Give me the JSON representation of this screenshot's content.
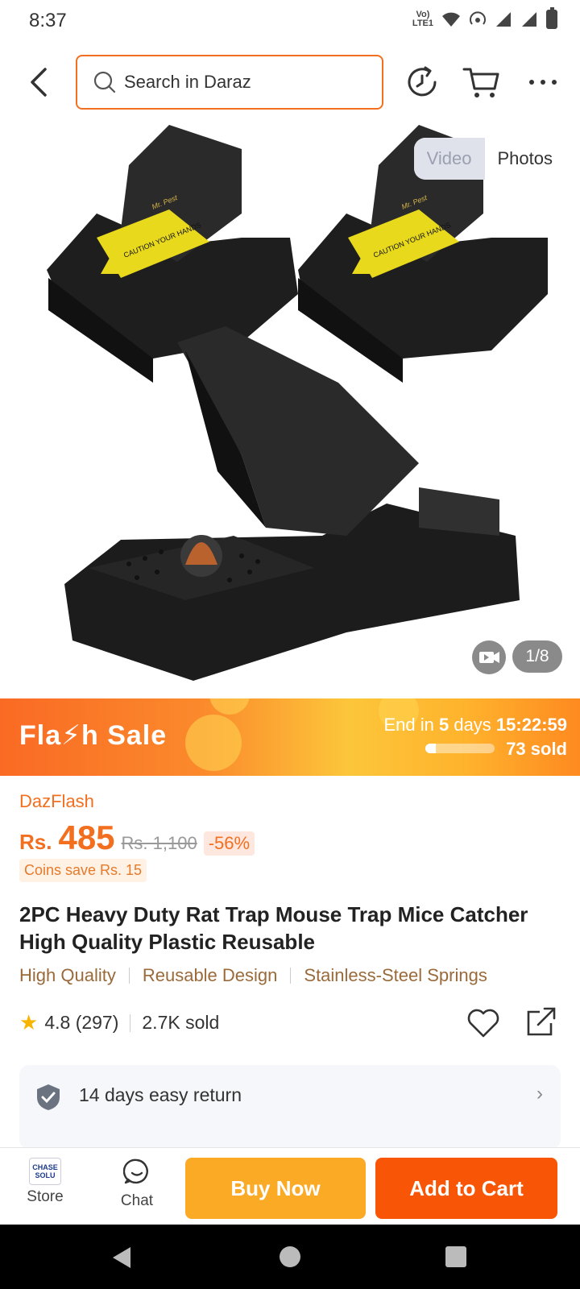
{
  "status_bar": {
    "time": "8:37",
    "lte_top": "Vo)",
    "lte_bottom": "LTE1"
  },
  "header": {
    "search_placeholder": "Search in Daraz"
  },
  "gallery": {
    "video_label": "Video",
    "photos_label": "Photos",
    "counter": "1/8",
    "trap_brand": "Mr. Pest",
    "trap_warning": "CAUTION YOUR HANDS"
  },
  "flash_sale": {
    "title": "Fla⚡h  Sale",
    "end_prefix": "End in ",
    "end_days": "5",
    "end_days_suffix": " days ",
    "end_time": "15:22:59",
    "sold_text": "73 sold",
    "progress": 0.15
  },
  "price": {
    "campaign": "DazFlash",
    "currency": "Rs.",
    "current": "485",
    "original": "Rs. 1,100",
    "discount": "-56%",
    "coins_save": "Coins save Rs. 15"
  },
  "product": {
    "title": "2PC Heavy Duty Rat Trap Mouse Trap Mice Catcher High Quality Plastic Reusable",
    "features": [
      "High Quality",
      "Reusable Design",
      "Stainless-Steel Springs"
    ],
    "rating": "4.8",
    "reviews": "(297)",
    "sold": "2.7K sold"
  },
  "service": {
    "return_text": "14 days easy return"
  },
  "action_bar": {
    "store_label": "Store",
    "store_logo": "CHASE SOLU",
    "chat_label": "Chat",
    "buy_now": "Buy Now",
    "add_to_cart": "Add to Cart"
  },
  "colors": {
    "accent": "#f85606",
    "buy_now": "#fbaa25",
    "search_border": "#f36f20"
  }
}
